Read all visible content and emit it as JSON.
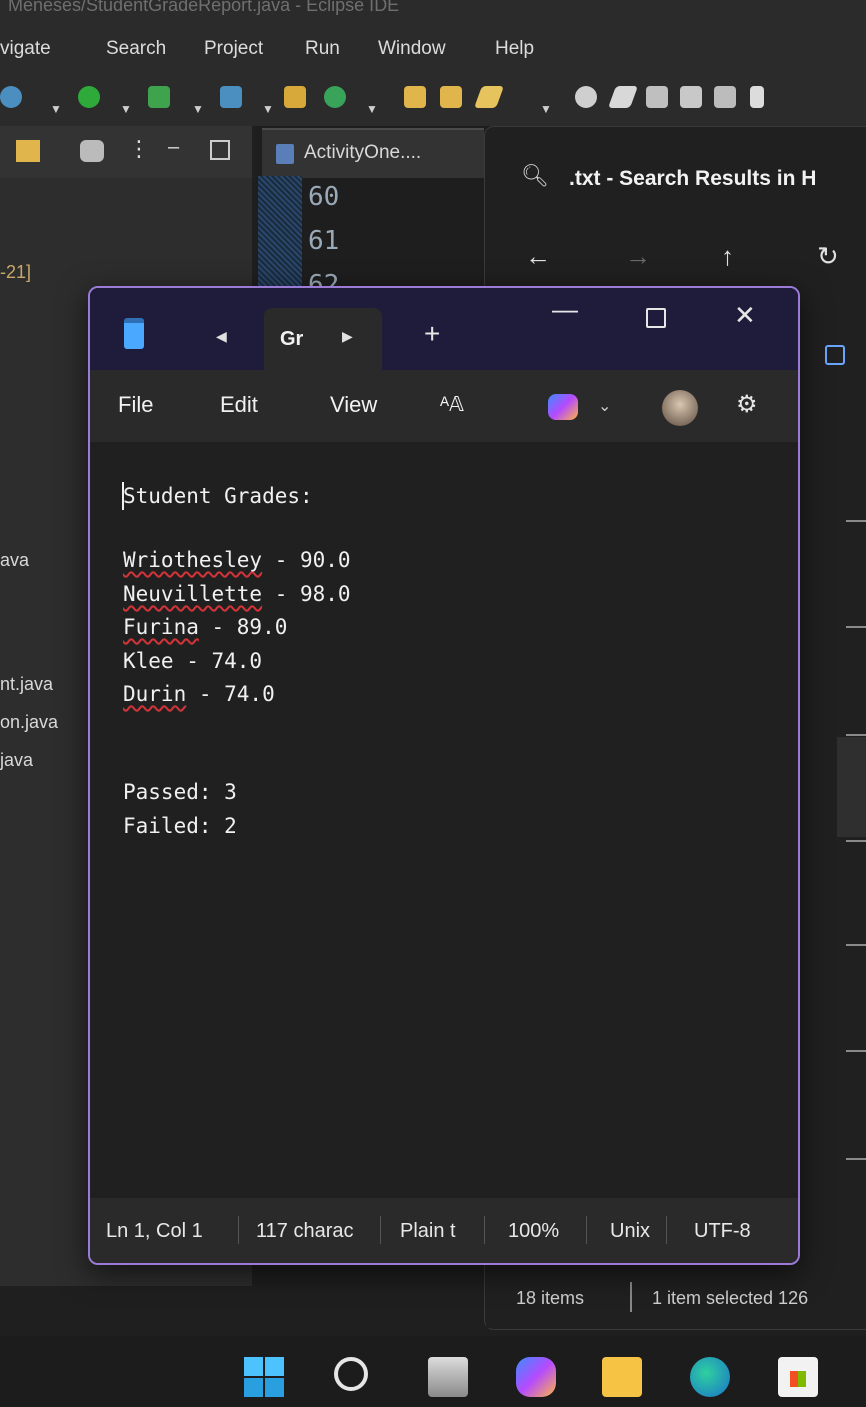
{
  "eclipse": {
    "window_title": "Meneses/StudentGradeReport.java - Eclipse IDE",
    "menu": [
      "vigate",
      "Search",
      "Project",
      "Run",
      "Window",
      "Help"
    ],
    "left_items": [
      "-21]",
      "ava",
      "nt.java",
      "on.java",
      "java"
    ],
    "editor_tab": "ActivityOne....",
    "line_numbers": [
      "60",
      "61",
      "62"
    ]
  },
  "explorer": {
    "title": ".txt - Search Results in H",
    "status_items": "18 items",
    "status_selected": "1 item selected  126"
  },
  "notepad": {
    "tab_label": "Gr",
    "menu": {
      "file": "File",
      "edit": "Edit",
      "view": "View"
    },
    "lines": {
      "l1": "Student Grades:",
      "s1_name": "Wriothesley",
      "s1_rest": " - 90.0",
      "s2_name": "Neuvillette",
      "s2_rest": " - 98.0",
      "s3_name": "Furina",
      "s3_rest": " - 89.0",
      "s4_name": "Klee",
      "s4_rest": " - 74.0",
      "s5_name": "Durin",
      "s5_rest": " - 74.0",
      "passed": "Passed: 3",
      "failed": "Failed: 2"
    },
    "status": {
      "position": "Ln 1, Col 1",
      "chars": "117 charac",
      "format": "Plain t",
      "zoom": "100%",
      "eol": "Unix",
      "encoding": "UTF-8"
    }
  },
  "colors": {
    "accent": "#9b7bd6",
    "title_bar": "#1f1b3a",
    "error_squiggle": "#d13438"
  }
}
